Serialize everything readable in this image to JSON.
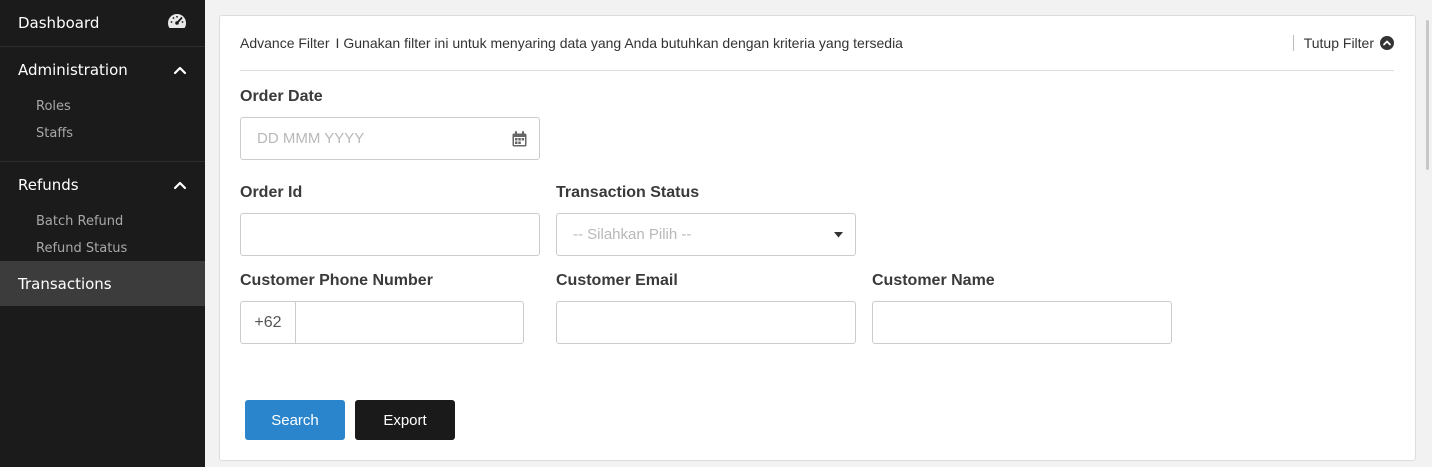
{
  "sidebar": {
    "dashboard": {
      "label": "Dashboard",
      "icon": "speedometer-icon"
    },
    "sections": [
      {
        "label": "Administration",
        "icon": "chevron-up-icon",
        "items": [
          "Roles",
          "Staffs"
        ]
      },
      {
        "label": "Refunds",
        "icon": "chevron-up-icon",
        "items": [
          "Batch Refund",
          "Refund Status"
        ]
      }
    ],
    "active": {
      "label": "Transactions"
    }
  },
  "filter": {
    "title": "Advance Filter",
    "separator": "I",
    "description": "Gunakan filter ini untuk menyaring data yang Anda butuhkan dengan kriteria yang tersedia",
    "close_label": "Tutup Filter",
    "close_icon": "chevron-up-circle-icon"
  },
  "fields": {
    "order_date": {
      "label": "Order Date",
      "placeholder": "DD MMM YYYY",
      "icon": "calendar-icon",
      "value": ""
    },
    "order_id": {
      "label": "Order Id",
      "value": ""
    },
    "transaction_status": {
      "label": "Transaction Status",
      "placeholder": "-- Silahkan Pilih --",
      "icon": "caret-down-icon"
    },
    "customer_phone": {
      "label": "Customer Phone Number",
      "prefix": "+62",
      "value": ""
    },
    "customer_email": {
      "label": "Customer Email",
      "value": ""
    },
    "customer_name": {
      "label": "Customer Name",
      "value": ""
    }
  },
  "buttons": {
    "search": "Search",
    "export": "Export"
  },
  "colors": {
    "sidebar_bg": "#1b1b1b",
    "active_bg": "#3c3c3c",
    "primary": "#2b85cc",
    "dark_button": "#1a1a1a"
  }
}
